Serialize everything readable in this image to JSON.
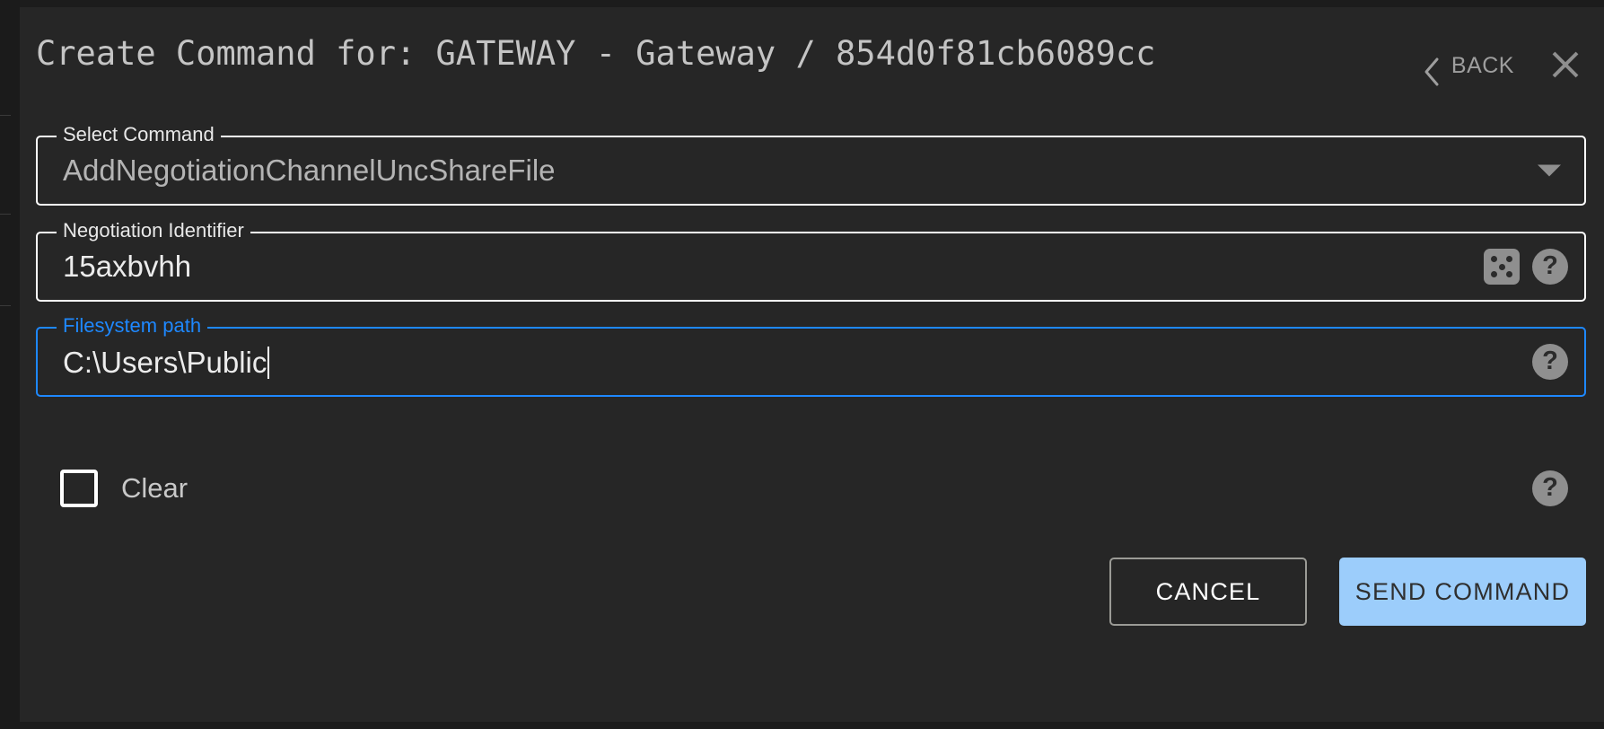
{
  "dialog": {
    "title": "Create Command for: GATEWAY - Gateway / 854d0f81cb6089cc",
    "back_label": "BACK",
    "back_icon": "chevron-left-icon",
    "close_icon": "close-icon"
  },
  "fields": {
    "select_command": {
      "label": "Select Command",
      "value": "AddNegotiationChannelUncShareFile",
      "arrow_icon": "chevron-down-icon"
    },
    "negotiation_identifier": {
      "label": "Negotiation Identifier",
      "value": "15axbvhh",
      "dice_icon": "dice-icon",
      "help_icon": "help-icon",
      "help_label": "?"
    },
    "filesystem_path": {
      "label": "Filesystem path",
      "value": "C:\\Users\\Public",
      "help_icon": "help-icon",
      "help_label": "?",
      "focused": true
    }
  },
  "clear_option": {
    "label": "Clear",
    "checked": false,
    "help_label": "?"
  },
  "actions": {
    "cancel_label": "CANCEL",
    "send_label": "SEND COMMAND"
  },
  "colors": {
    "dialog_background": "#262626",
    "page_background": "#1c1c1c",
    "focus_blue": "#1e88ff",
    "primary_button": "#9ccdfb",
    "outline_white": "#ffffff",
    "icon_gray": "#8f8f8f",
    "title_text": "#c4c4c4"
  }
}
